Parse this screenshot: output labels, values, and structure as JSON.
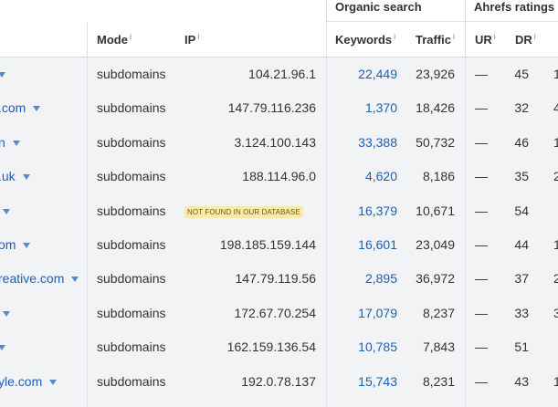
{
  "header": {
    "groups": {
      "organic": "Organic search",
      "ahrefs": "Ahrefs ratings"
    },
    "columns": {
      "mode": "Mode",
      "ip": "IP",
      "keywords": "Keywords",
      "traffic": "Traffic",
      "ur": "UR",
      "dr": "DR"
    },
    "info_glyph": "i"
  },
  "rows": [
    {
      "domain": "",
      "mode": "subdomains",
      "ip": "104.21.96.1",
      "keywords": "22,449",
      "traffic": "23,926",
      "ur": "—",
      "dr": "45",
      "extra": "1"
    },
    {
      "domain": ".com",
      "mode": "subdomains",
      "ip": "147.79.116.236",
      "keywords": "1,370",
      "traffic": "18,426",
      "ur": "—",
      "dr": "32",
      "extra": "4"
    },
    {
      "domain": "n",
      "mode": "subdomains",
      "ip": "3.124.100.143",
      "keywords": "33,388",
      "traffic": "50,732",
      "ur": "—",
      "dr": "46",
      "extra": "1"
    },
    {
      "domain": ".uk",
      "mode": "subdomains",
      "ip": "188.114.96.0",
      "keywords": "4,620",
      "traffic": "8,186",
      "ur": "—",
      "dr": "35",
      "extra": "2"
    },
    {
      "domain": "",
      "mode": "subdomains",
      "ip": "NOT FOUND IN OUR DATABASE",
      "ip_missing": true,
      "keywords": "16,379",
      "traffic": "10,671",
      "ur": "—",
      "dr": "54",
      "extra": ""
    },
    {
      "domain": "om",
      "mode": "subdomains",
      "ip": "198.185.159.144",
      "keywords": "16,601",
      "traffic": "23,049",
      "ur": "—",
      "dr": "44",
      "extra": "1"
    },
    {
      "domain": "reative.com",
      "mode": "subdomains",
      "ip": "147.79.119.56",
      "keywords": "2,895",
      "traffic": "36,972",
      "ur": "—",
      "dr": "37",
      "extra": "2"
    },
    {
      "domain": "",
      "mode": "subdomains",
      "ip": "172.67.70.254",
      "keywords": "17,079",
      "traffic": "8,237",
      "ur": "—",
      "dr": "33",
      "extra": "3"
    },
    {
      "domain": "",
      "mode": "subdomains",
      "ip": "162.159.136.54",
      "keywords": "10,785",
      "traffic": "7,843",
      "ur": "—",
      "dr": "51",
      "extra": ""
    },
    {
      "domain": "yle.com",
      "mode": "subdomains",
      "ip": "192.0.78.137",
      "keywords": "15,743",
      "traffic": "8,231",
      "ur": "—",
      "dr": "43",
      "extra": "1"
    }
  ]
}
